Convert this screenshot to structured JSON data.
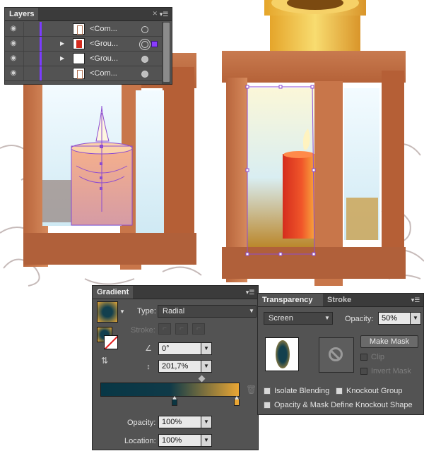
{
  "colors": {
    "panel_bg": "#535353",
    "selection": "#8a3cff",
    "gradient_start": "#083746",
    "gradient_end": "#e9a634"
  },
  "layers_panel": {
    "tab": "Layers",
    "menu_icon": "panel-menu-icon",
    "rows": [
      {
        "name": "<Com...",
        "expandable": false,
        "thumb": "candle-thumb-icon"
      },
      {
        "name": "<Grou...",
        "expandable": true,
        "thumb": "red-candle-thumb-icon",
        "selected": true
      },
      {
        "name": "<Grou...",
        "expandable": true,
        "thumb": "blank-thumb-icon"
      },
      {
        "name": "<Com...",
        "expandable": false,
        "thumb": "candle-thumb-icon"
      }
    ]
  },
  "gradient_panel": {
    "tab": "Gradient",
    "type_label": "Type:",
    "type_value": "Radial",
    "stroke_label": "Stroke:",
    "angle_value": "0°",
    "aspect_value": "201,7%",
    "opacity_label": "Opacity:",
    "opacity_value": "100%",
    "location_label": "Location:",
    "location_value": "100%"
  },
  "transparency_panel": {
    "tab_active": "Transparency",
    "tab_inactive": "Stroke",
    "blend_mode": "Screen",
    "opacity_label": "Opacity:",
    "opacity_value": "50%",
    "make_mask": "Make Mask",
    "clip": "Clip",
    "invert_mask": "Invert Mask",
    "isolate_blending": "Isolate Blending",
    "knockout_group": "Knockout Group",
    "opacity_mask_knockout": "Opacity & Mask Define Knockout Shape"
  }
}
